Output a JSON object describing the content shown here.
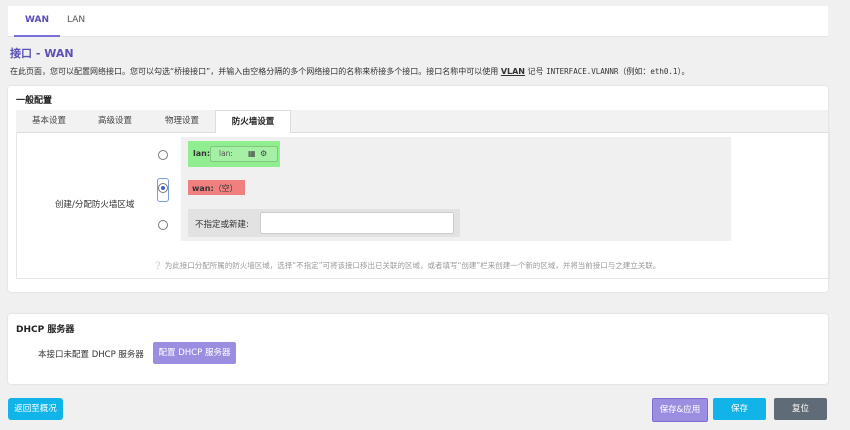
{
  "tabs": {
    "wan": "WAN",
    "lan": "LAN"
  },
  "page": {
    "title": "接口 - WAN",
    "description_pre": "在此页面，您可以配置网络接口。您可以勾选“桥接接口”，并输入由空格分隔的多个网络接口的名称来桥接多个接口。接口名称中可以使用 ",
    "vlan": "VLAN",
    "description_mid": " 记号 ",
    "vlan_notation": "INTERFACE.VLANNR",
    "description_post": "（例如：",
    "example": "eth0.1",
    "description_end": "）。"
  },
  "general": {
    "section_title": "一般配置",
    "subtabs": [
      "基本设置",
      "高级设置",
      "物理设置",
      "防火墙设置"
    ],
    "active_subtab": 3,
    "field_label": "创建/分配防火墙区域",
    "zones": {
      "lan_name": "lan:",
      "lan_chip": "lan:",
      "wan_name": "wan:",
      "wan_empty": "（空）",
      "new_label": "不指定或新建:",
      "new_value": ""
    },
    "hint": "为此接口分配所属的防火墙区域，选择“不指定”可将该接口移出已关联的区域，或者填写“创建”栏来创建一个新的区域，并将当前接口与之建立关联。",
    "zone_colors": {
      "lan": "#90ee90",
      "wan": "#f08080"
    }
  },
  "dhcp": {
    "section_title": "DHCP 服务器",
    "text": "本接口未配置 DHCP 服务器",
    "button": "配置 DHCP 服务器"
  },
  "footer": {
    "back": "返回至概况",
    "save_apply": "保存&应用",
    "save": "保存",
    "reset": "复位"
  }
}
